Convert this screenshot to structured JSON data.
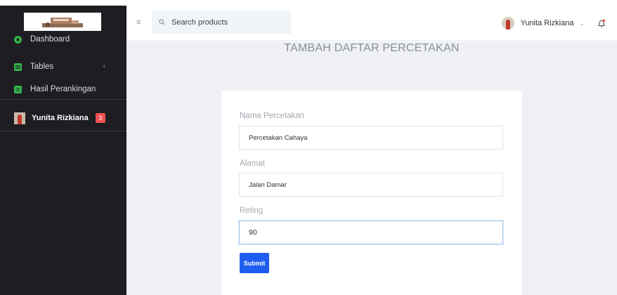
{
  "sidebar": {
    "items": [
      {
        "label": "Dashboard",
        "icon": "dashboard-icon"
      },
      {
        "label": "Tables",
        "icon": "table-icon"
      },
      {
        "label": "Hasil Perankingan",
        "icon": "list-icon"
      }
    ],
    "user": {
      "name": "Yunita Rizkiana",
      "badge": "3"
    }
  },
  "topbar": {
    "search_placeholder": "Search products",
    "user_name": "Yunita Rizkiana"
  },
  "page": {
    "title": "TAMBAH DAFTAR PERCETAKAN"
  },
  "form": {
    "fields": [
      {
        "label": "Nama Percetakan",
        "value": "Percetakan Cahaya"
      },
      {
        "label": "Alamat",
        "value": "Jalan Damar"
      },
      {
        "label": "Reting",
        "value": "90"
      }
    ],
    "submit_label": "Submit"
  },
  "colors": {
    "sidebar_bg": "#1d1d22",
    "accent_green": "#34b34a",
    "primary_button": "#1e5df0",
    "badge_red": "#f05050",
    "content_bg": "#eef0f4"
  }
}
